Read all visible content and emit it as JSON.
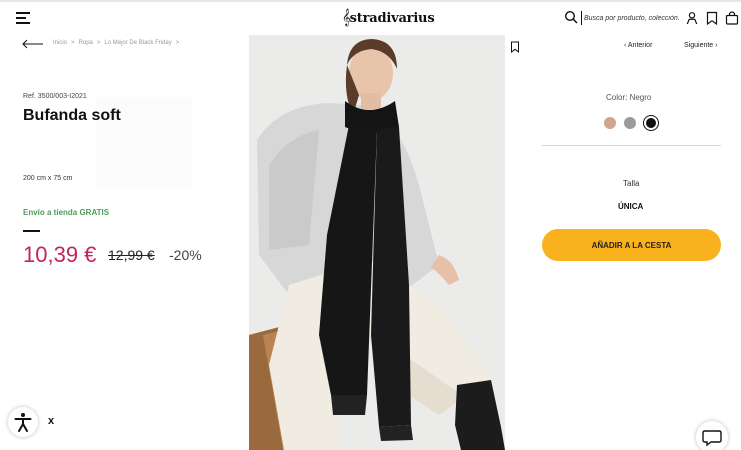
{
  "header": {
    "logo_mark": "𝄞",
    "logo_text": "stradivarius",
    "search_placeholder": "Busca por producto, colección..."
  },
  "breadcrumb": {
    "items": [
      "Inicio",
      "Ropa",
      "Lo Mejor De Black Friday"
    ],
    "separator": ">"
  },
  "product": {
    "ref": "Ref. 3500/003-I2021",
    "name": "Bufanda soft",
    "dimensions": "200 cm x 75 cm",
    "shipping": "Envío a tienda GRATIS",
    "price_now": "10,39 €",
    "price_old": "12,99 €",
    "discount": "-20%"
  },
  "navigation": {
    "prev_label": "Anterior",
    "next_label": "Siguiente"
  },
  "color": {
    "label": "Color: Negro",
    "swatches": [
      "#cfa68c",
      "#9b9b9b",
      "#111111"
    ],
    "selected_index": 2
  },
  "size": {
    "label": "Talla",
    "value": "ÚNICA"
  },
  "cart": {
    "add_label": "AÑADIR A LA CESTA"
  },
  "accessibility": {
    "close_label": "x"
  },
  "colors": {
    "accent_price": "#c3245d",
    "shipping_green": "#4f9a5c",
    "cta_yellow": "#f9b21e"
  }
}
